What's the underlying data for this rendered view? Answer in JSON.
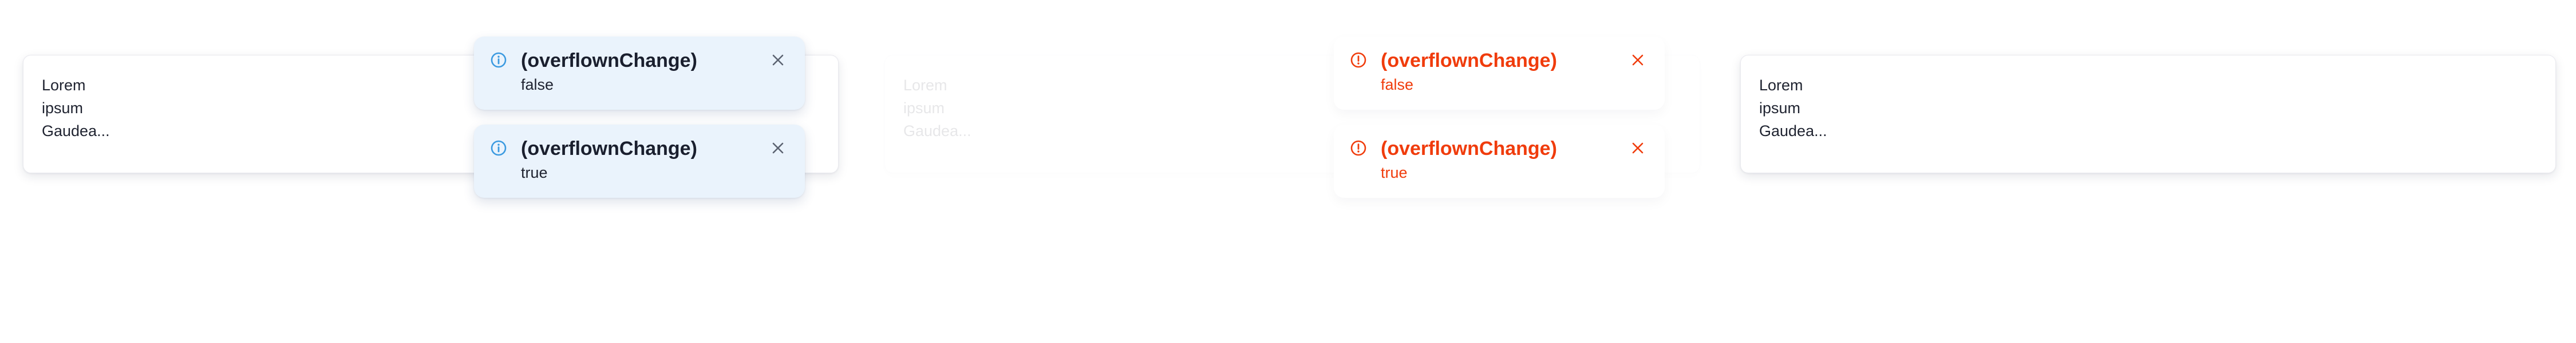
{
  "cards": [
    {
      "lines": [
        "Lorem",
        "ipsum",
        "Gaudea..."
      ]
    },
    {
      "lines": [
        "Lorem",
        "ipsum",
        "Gaudea..."
      ]
    },
    {
      "lines": [
        "Lorem",
        "ipsum",
        "Gaudea..."
      ]
    }
  ],
  "info_toasts": [
    {
      "title": "(overflownChange)",
      "body": "false",
      "icon": "info-icon",
      "close_icon": "close-icon"
    },
    {
      "title": "(overflownChange)",
      "body": "true",
      "icon": "info-icon",
      "close_icon": "close-icon"
    }
  ],
  "error_toasts": [
    {
      "title": "(overflownChange)",
      "body": "false",
      "icon": "error-icon",
      "close_icon": "close-icon"
    },
    {
      "title": "(overflownChange)",
      "body": "true",
      "icon": "error-icon",
      "close_icon": "close-icon"
    }
  ],
  "colors": {
    "info_bg": "#eaf3fc",
    "info_icon": "#3b9ae0",
    "error": "#f03c0c",
    "text": "#1f2330"
  }
}
